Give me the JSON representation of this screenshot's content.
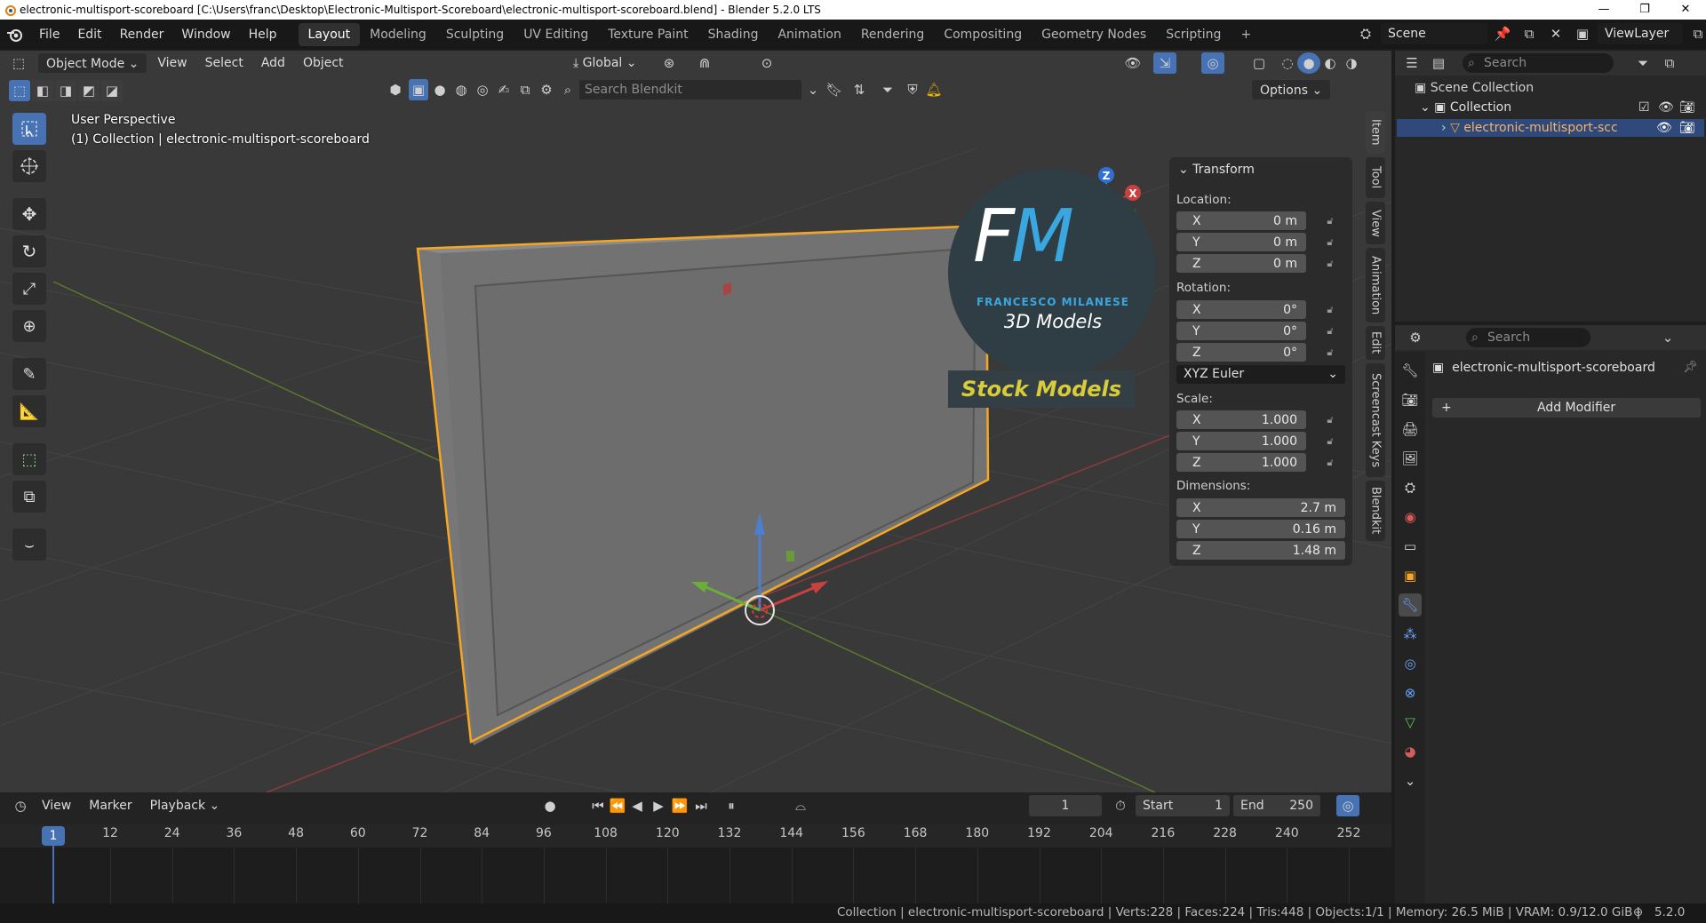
{
  "window": {
    "title": "electronic-multisport-scoreboard [C:\\Users\\franc\\Desktop\\Electronic-Multisport-Scoreboard\\electronic-multisport-scoreboard.blend] - Blender 5.2.0 LTS",
    "controls": [
      "—",
      "❐",
      "✕"
    ]
  },
  "menu": [
    "File",
    "Edit",
    "Render",
    "Window",
    "Help"
  ],
  "workspaces": [
    "Layout",
    "Modeling",
    "Sculpting",
    "UV Editing",
    "Texture Paint",
    "Shading",
    "Animation",
    "Rendering",
    "Compositing",
    "Geometry Nodes",
    "Scripting"
  ],
  "scene": {
    "label": "Scene",
    "view_layer": "ViewLayer"
  },
  "viewport_header": {
    "mode": "Object Mode",
    "menus": [
      "View",
      "Select",
      "Add",
      "Object"
    ],
    "orientation": "Global",
    "search_placeholder": "Search Blendkit",
    "options": "Options"
  },
  "viewport": {
    "perspective": "User Perspective",
    "collection_info": "(1) Collection | electronic-multisport-scoreboard",
    "watermark": {
      "letters": "FM",
      "name": "FRANCESCO MILANESE",
      "subtitle": "3D Models",
      "banner": "Stock Models"
    }
  },
  "transform_panel": {
    "title": "Transform",
    "location_label": "Location:",
    "location": [
      {
        "axis": "X",
        "value": "0 m"
      },
      {
        "axis": "Y",
        "value": "0 m"
      },
      {
        "axis": "Z",
        "value": "0 m"
      }
    ],
    "rotation_label": "Rotation:",
    "rotation": [
      {
        "axis": "X",
        "value": "0°"
      },
      {
        "axis": "Y",
        "value": "0°"
      },
      {
        "axis": "Z",
        "value": "0°"
      }
    ],
    "rotation_mode": "XYZ Euler",
    "scale_label": "Scale:",
    "scale": [
      {
        "axis": "X",
        "value": "1.000"
      },
      {
        "axis": "Y",
        "value": "1.000"
      },
      {
        "axis": "Z",
        "value": "1.000"
      }
    ],
    "dimensions_label": "Dimensions:",
    "dimensions": [
      {
        "axis": "X",
        "value": "2.7 m"
      },
      {
        "axis": "Y",
        "value": "0.16 m"
      },
      {
        "axis": "Z",
        "value": "1.48 m"
      }
    ]
  },
  "side_tabs": [
    "Item",
    "Tool",
    "View",
    "Animation",
    "Edit",
    "Screencast Keys",
    "Blendkit"
  ],
  "outliner": {
    "search_placeholder": "Search",
    "scene_collection": "Scene Collection",
    "collection": "Collection",
    "object": "electronic-multisport-scc"
  },
  "properties": {
    "search_placeholder": "Search",
    "object_name": "electronic-multisport-scoreboard",
    "add_modifier": "Add Modifier"
  },
  "timeline": {
    "menus": [
      "View",
      "Marker",
      "Playback"
    ],
    "current_frame": "1",
    "start_label": "Start",
    "start": "1",
    "end_label": "End",
    "end": "250",
    "cursor_frame": "1",
    "ticks": [
      "12",
      "24",
      "36",
      "48",
      "60",
      "72",
      "84",
      "96",
      "108",
      "120",
      "132",
      "144",
      "156",
      "168",
      "180",
      "192",
      "204",
      "216",
      "228",
      "240",
      "252"
    ]
  },
  "status_bar": {
    "text": "Collection | electronic-multisport-scoreboard | Verts:228 | Faces:224 | Tris:448 | Objects:1/1 | Memory: 26.5 MiB | VRAM: 0.9/12.0 GiB |",
    "version": "5.2.0"
  },
  "colors": {
    "selection_orange": "#f5a623",
    "accent_blue": "#4772b3",
    "active_highlight": "#2f4a7a",
    "watermark_blue": "#3ba7e0",
    "watermark_yellow": "#d8cc3a"
  }
}
